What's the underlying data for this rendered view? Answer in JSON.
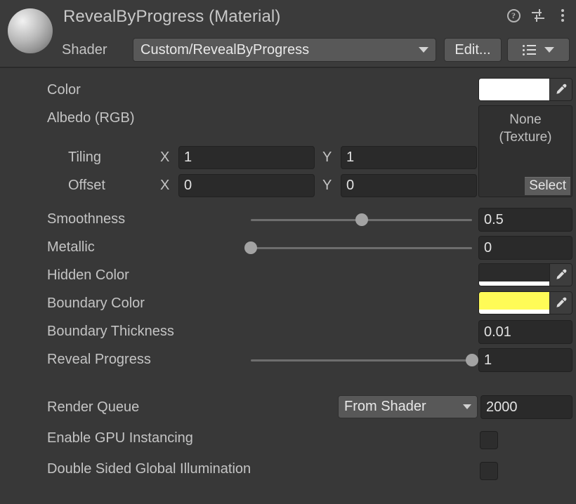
{
  "header": {
    "title": "RevealByProgress (Material)",
    "preview_icon": "material-sphere-preview",
    "help_icon": "?",
    "preset_icon": "preset-sliders-icon",
    "menu_icon": "kebab-menu-icon",
    "shader_label": "Shader",
    "shader_value": "Custom/RevealByProgress",
    "edit_label": "Edit...",
    "preset_dropdown_icon": "shader-list-icon"
  },
  "properties": {
    "color": {
      "label": "Color",
      "swatch_hex": "#FFFFFF",
      "alpha_hex": "#FFFFFF",
      "eyedropper_icon": "eyedropper-icon"
    },
    "albedo": {
      "label": "Albedo (RGB)",
      "texture_value": "None",
      "texture_type": "(Texture)",
      "select_label": "Select",
      "tiling_label": "Tiling",
      "tiling_x_axis": "X",
      "tiling_x": "1",
      "tiling_y_axis": "Y",
      "tiling_y": "1",
      "offset_label": "Offset",
      "offset_x_axis": "X",
      "offset_x": "0",
      "offset_y_axis": "Y",
      "offset_y": "0"
    },
    "smoothness": {
      "label": "Smoothness",
      "value": "0.5",
      "slider_pct": 50
    },
    "metallic": {
      "label": "Metallic",
      "value": "0",
      "slider_pct": 0
    },
    "hidden_color": {
      "label": "Hidden Color",
      "swatch_hex": "#2B2B2B",
      "alpha_hex": "#FFFFFF",
      "eyedropper_icon": "eyedropper-icon"
    },
    "boundary_color": {
      "label": "Boundary Color",
      "swatch_hex": "#FFFB57",
      "alpha_hex": "#FFFFFF",
      "eyedropper_icon": "eyedropper-icon"
    },
    "boundary_thickness": {
      "label": "Boundary Thickness",
      "value": "0.01"
    },
    "reveal_progress": {
      "label": "Reveal Progress",
      "value": "1",
      "slider_pct": 100
    }
  },
  "footer": {
    "render_queue_label": "Render Queue",
    "render_queue_mode": "From Shader",
    "render_queue_value": "2000",
    "gpu_instancing_label": "Enable GPU Instancing",
    "gpu_instancing_checked": false,
    "double_sided_gi_label": "Double Sided Global Illumination",
    "double_sided_gi_checked": false
  },
  "colors": {
    "panel_bg": "#383838",
    "header_bg": "#3B3B3B",
    "field_bg": "#2A2A2A",
    "button_bg": "#585858",
    "text": "#C4C4C4"
  }
}
